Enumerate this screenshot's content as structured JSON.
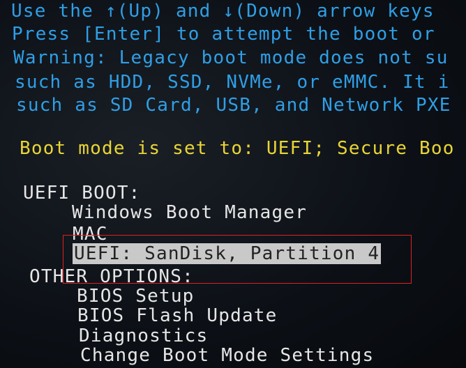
{
  "instructions": [
    "Use the ↑(Up) and ↓(Down) arrow keys",
    "Press [Enter] to attempt the boot or",
    "Warning: Legacy boot mode does not su",
    "such as HDD, SSD, NVMe, or eMMC. It i",
    "such as SD Card, USB, and Network PXE"
  ],
  "boot_mode_status": "Boot mode is set to: UEFI; Secure Boo",
  "uefi_boot": {
    "heading": "UEFI BOOT:",
    "items": [
      "Windows Boot Manager",
      "MAC",
      "UEFI: SanDisk, Partition 4"
    ],
    "selected_index": 2
  },
  "other_options": {
    "heading": "OTHER OPTIONS:",
    "items": [
      "BIOS Setup",
      "BIOS Flash Update",
      "Diagnostics",
      "Change Boot Mode Settings"
    ]
  },
  "colors": {
    "instruction_text": "#2f9fe6",
    "status_text": "#e9d536",
    "menu_text": "#e6e6e6",
    "highlight": "#c9c9c9",
    "annotation_box": "#e02020"
  }
}
